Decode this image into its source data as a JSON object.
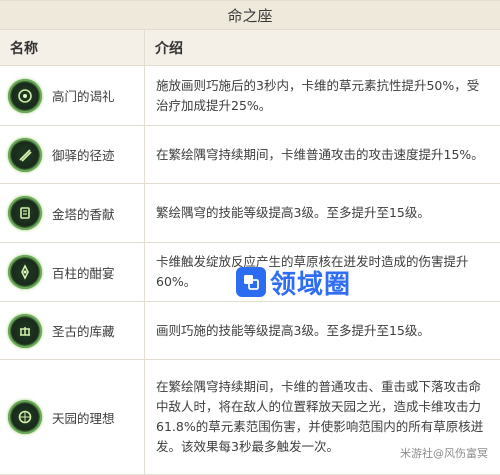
{
  "table": {
    "title": "命之座",
    "headers": {
      "name": "名称",
      "desc": "介绍"
    },
    "rows": [
      {
        "name": "高门的谒礼",
        "icon": "constellation-1-icon",
        "desc": "施放画则巧施后的3秒内，卡维的草元素抗性提升50%，受治疗加成提升25%。"
      },
      {
        "name": "御驿的径迹",
        "icon": "constellation-2-icon",
        "desc": "在繁绘隅穹持续期间，卡维普通攻击的攻击速度提升15%。"
      },
      {
        "name": "金塔的香献",
        "icon": "constellation-3-icon",
        "desc": "繁绘隅穹的技能等级提高3级。至多提升至15级。"
      },
      {
        "name": "百柱的酣宴",
        "icon": "constellation-4-icon",
        "desc": "卡维触发绽放反应产生的草原核在迸发时造成的伤害提升60%。"
      },
      {
        "name": "圣古的库藏",
        "icon": "constellation-5-icon",
        "desc": "画则巧施的技能等级提高3级。至多提升至15级。"
      },
      {
        "name": "天园的理想",
        "icon": "constellation-6-icon",
        "desc": "在繁绘隅穹持续期间，卡维的普通攻击、重击或下落攻击命中敌人时，将在敌人的位置释放天园之光，造成卡维攻击力61.8%的草元素范围伤害，并使影响范围内的所有草原核迸发。该效果每3秒最多触发一次。"
      }
    ]
  },
  "watermark": {
    "text": "领域圈",
    "credit": "米游社@风伤富冥"
  },
  "colors": {
    "title_bg": "#efe9dc",
    "header_bg": "#f4f0e7",
    "border": "#e3ddd0",
    "watermark": "#2f6ef2"
  }
}
